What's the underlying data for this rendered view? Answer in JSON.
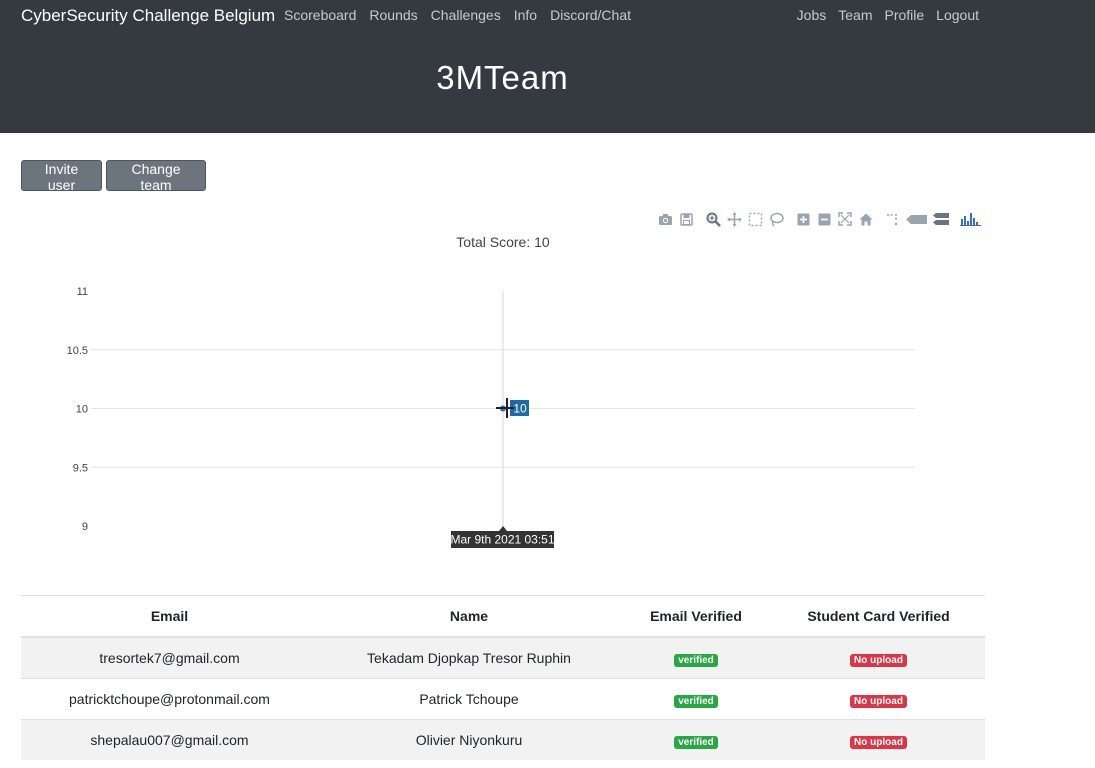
{
  "nav": {
    "brand": "CyberSecurity Challenge Belgium",
    "left_links": [
      "Scoreboard",
      "Rounds",
      "Challenges",
      "Info",
      "Discord/Chat"
    ],
    "right_links": [
      "Jobs",
      "Team",
      "Profile",
      "Logout"
    ]
  },
  "page": {
    "title": "3MTeam"
  },
  "buttons": {
    "invite": "Invite user",
    "change_team": "Change team"
  },
  "modebar_icons": [
    "camera-icon",
    "save-icon",
    "zoom-icon",
    "pan-icon",
    "box-select-icon",
    "lasso-select-icon",
    "zoom-in-icon",
    "zoom-out-icon",
    "autoscale-icon",
    "reset-axes-icon",
    "spike-lines-icon",
    "hover-closest-icon",
    "hover-compare-icon",
    "plotly-logo-icon"
  ],
  "chart_data": {
    "type": "line",
    "title": "Total Score: 10",
    "yticks": [
      "11",
      "10.5",
      "10",
      "9.5",
      "9"
    ],
    "ylim": [
      9,
      11
    ],
    "series": [
      {
        "x": [
          "Mar 9th 2021 03:51"
        ],
        "values": [
          10
        ]
      }
    ],
    "hover": {
      "value_label": "10",
      "x_label": "Mar 9th 2021 03:51"
    },
    "grid": true,
    "line_color": "#1f77b4"
  },
  "table": {
    "headers": [
      "Email",
      "Name",
      "Email Verified",
      "Student Card Verified"
    ],
    "rows": [
      {
        "email": "tresortek7@gmail.com",
        "name": "Tekadam Djopkap Tresor Ruphin",
        "email_verified": "verified",
        "card": "No upload"
      },
      {
        "email": "patricktchoupe@protonmail.com",
        "name": "Patrick Tchoupe",
        "email_verified": "verified",
        "card": "No upload"
      },
      {
        "email": "shepalau007@gmail.com",
        "name": "Olivier Niyonkuru",
        "email_verified": "verified",
        "card": "No upload"
      }
    ]
  },
  "colors": {
    "navbar": "#343a40",
    "button": "#6c757d",
    "verified": "#28a745",
    "no_upload": "#dc3545"
  }
}
